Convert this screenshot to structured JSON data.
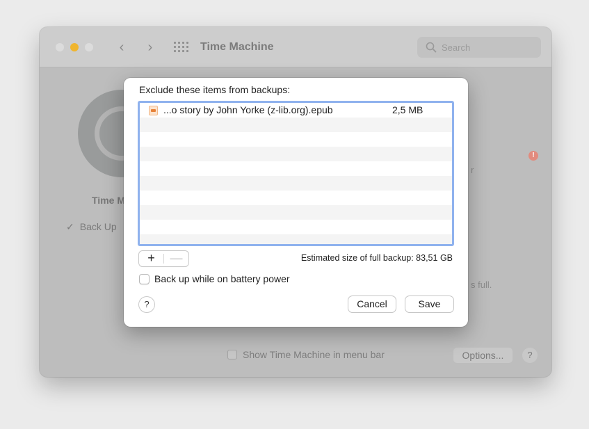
{
  "window": {
    "title": "Time Machine",
    "search_placeholder": "Search",
    "bg_label": "Time M",
    "bg_backup_check": "Back Up",
    "bg_right_fragment": "r",
    "bg_full_fragment": "s full.",
    "show_menu_bar": "Show Time Machine in menu bar",
    "options_label": "Options...",
    "help_label": "?",
    "info_badge": "!"
  },
  "sheet": {
    "title": "Exclude these items from backups:",
    "items": [
      {
        "name": "...o story by John Yorke (z-lib.org).epub",
        "size": "2,5 MB",
        "icon": "epub-file-icon"
      }
    ],
    "add_label": "+",
    "remove_label": "—",
    "estimated_size": "Estimated size of full backup: 83,51 GB",
    "battery_label": "Back up while on battery power",
    "battery_checked": false,
    "help_label": "?",
    "cancel_label": "Cancel",
    "save_label": "Save"
  },
  "colors": {
    "list_focus_ring": "#8fb2ee",
    "traffic_minimize": "#f0b52e",
    "alert_badge": "#e28b7e"
  }
}
